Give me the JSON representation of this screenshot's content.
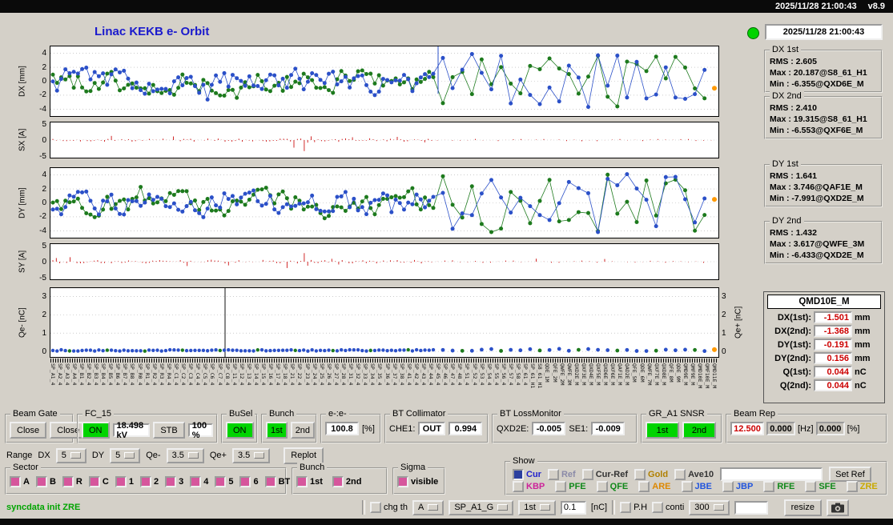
{
  "titlebar": {
    "clock": "2025/11/28 21:00:43",
    "version": "v8.9"
  },
  "header": {
    "title": "Linac KEKB e- Orbit",
    "status_time": "2025/11/28 21:00:43"
  },
  "colors": {
    "on_green": "#00d400",
    "value_red": "#cc0000",
    "check_pink": "#d6569c",
    "check_blue": "#2b3f9e",
    "title_blue": "#1a1acd",
    "status_green": "#00a400",
    "series_green": "#1d7a1d",
    "series_blue": "#2b50c8",
    "spike_red": "#cc1111",
    "endpoint_orange": "#ff9900"
  },
  "plots": {
    "dx": {
      "ylabel": "DX [mm]",
      "ticks": [
        4,
        2,
        0,
        -2,
        -4
      ]
    },
    "sx": {
      "ylabel": "SX [A]",
      "ticks": [
        5,
        0,
        -5
      ]
    },
    "dy": {
      "ylabel": "DY [mm]",
      "ticks": [
        4,
        2,
        0,
        -2,
        -4
      ]
    },
    "sy": {
      "ylabel": "SY [A]",
      "ticks": [
        5,
        0,
        -5
      ]
    },
    "qe": {
      "ylabel": "Qe- [nC]",
      "ylabel_right": "Qe+ [nC]",
      "ticks": [
        3,
        2,
        1,
        0
      ],
      "ticks_right": [
        3,
        2,
        1,
        0
      ]
    }
  },
  "stats": [
    {
      "group": "DX 1st",
      "lines": [
        "RMS : 2.605",
        "Max : 20.187@S8_61_H1",
        "Min : -6.355@QXD6E_M"
      ]
    },
    {
      "group": "DX 2nd",
      "lines": [
        "RMS : 2.410",
        "Max : 19.315@S8_61_H1",
        "Min : -6.553@QXF6E_M"
      ]
    },
    {
      "group": "DY 1st",
      "lines": [
        "RMS : 1.641",
        "Max : 3.746@QAF1E_M",
        "Min : -7.991@QXD2E_M"
      ]
    },
    {
      "group": "DY 2nd",
      "lines": [
        "RMS : 1.432",
        "Max : 3.617@QWFE_3M",
        "Min : -6.433@QXD2E_M"
      ]
    }
  ],
  "monitor": {
    "title": "QMD10E_M",
    "rows": [
      {
        "label": "DX(1st):",
        "value": "-1.501",
        "unit": "mm"
      },
      {
        "label": "DX(2nd):",
        "value": "-1.368",
        "unit": "mm"
      },
      {
        "label": "DY(1st):",
        "value": "-0.191",
        "unit": "mm"
      },
      {
        "label": "DY(2nd):",
        "value": "0.156",
        "unit": "mm"
      },
      {
        "label": "Q(1st):",
        "value": "0.044",
        "unit": "nC"
      },
      {
        "label": "Q(2nd):",
        "value": "0.044",
        "unit": "nC"
      }
    ]
  },
  "controls": {
    "beam_gate": {
      "label": "Beam Gate",
      "close1": "Close",
      "close2": "Close"
    },
    "fc15": {
      "label": "FC_15",
      "on": "ON",
      "kv": "18.498 kV",
      "stb": "STB",
      "pct": "100 %"
    },
    "busel": {
      "label": "BuSel",
      "on": "ON"
    },
    "bunch": {
      "label": "Bunch",
      "first": "1st",
      "second": "2nd"
    },
    "ee": {
      "label": "e-:e-",
      "value": "100.8",
      "unit": "[%]"
    },
    "collimator": {
      "label": "BT Collimator",
      "che1": "CHE1:",
      "out": "OUT",
      "val": "0.994"
    },
    "lossmon": {
      "label": "BT LossMonitor",
      "l1": "QXD2E:",
      "v1": "-0.005",
      "l2": "SE1:",
      "v2": "-0.009"
    },
    "snsr": {
      "label": "GR_A1 SNSR",
      "first": "1st",
      "second": "2nd"
    },
    "beamrep": {
      "label": "Beam Rep",
      "v1": "12.500",
      "v2": "0.000",
      "hz": "[Hz]",
      "v3": "0.000",
      "pct": "[%]"
    }
  },
  "range": {
    "label": "Range",
    "dx": "DX",
    "dx_val": "5",
    "dy": "DY",
    "dy_val": "5",
    "qem": "Qe-",
    "qem_val": "3.5",
    "qep": "Qe+",
    "qep_val": "3.5",
    "replot": "Replot"
  },
  "sector": {
    "label": "Sector",
    "items": [
      "A",
      "B",
      "R",
      "C",
      "1",
      "2",
      "3",
      "4",
      "5",
      "6",
      "BT"
    ]
  },
  "bunch_sel": {
    "label": "Bunch",
    "items": [
      "1st",
      "2nd"
    ]
  },
  "sigma": {
    "label": "Sigma",
    "item": "visible"
  },
  "show": {
    "label": "Show",
    "row1": [
      {
        "label": "Cur",
        "color": "#2222cc",
        "checked": true
      },
      {
        "label": "Ref",
        "color": "#8a8aa8",
        "checked": false
      },
      {
        "label": "Cur-Ref",
        "color": "#333333",
        "checked": false
      },
      {
        "label": "Gold",
        "color": "#b08000",
        "checked": false
      },
      {
        "label": "Ave10",
        "color": "#333333",
        "checked": false
      }
    ],
    "ref_entry": "",
    "set_ref": "Set Ref",
    "row2": [
      {
        "label": "KBP",
        "color": "#cc2299"
      },
      {
        "label": "PFE",
        "color": "#11881a"
      },
      {
        "label": "QFE",
        "color": "#11881a"
      },
      {
        "label": "ARE",
        "color": "#dd8800"
      },
      {
        "label": "JBE",
        "color": "#2255dd"
      },
      {
        "label": "JBP",
        "color": "#2255dd"
      },
      {
        "label": "RFE",
        "color": "#11881a"
      },
      {
        "label": "SFE",
        "color": "#11881a"
      },
      {
        "label": "ZRE",
        "color": "#c8a800"
      }
    ]
  },
  "statusbar": {
    "message": "syncdata init ZRE",
    "chg_th": "chg th",
    "mode": "A",
    "device": "SP_A1_G",
    "bunch": "1st",
    "threshold": "0.1",
    "th_unit": "[nC]",
    "ph": "P.H",
    "conti": "conti",
    "interval": "300",
    "blank": "",
    "resize": "resize"
  },
  "xlabels": [
    "SP_A1_4",
    "SP_A2_4",
    "SP_A3_4",
    "SP_A4_4",
    "SP_B1_4",
    "SP_B2_4",
    "SP_B3_4",
    "SP_B4_4",
    "SP_B5_4",
    "SP_B6_4",
    "SP_B7_4",
    "SP_B8_4",
    "SP_R0_4",
    "SP_R1_4",
    "SP_R2_4",
    "SP_R3_4",
    "SP_R4_4",
    "SP_C1_4",
    "SP_C2_4",
    "SP_C3_4",
    "SP_C4_4",
    "SP_C5_4",
    "SP_C6_4",
    "SP_C7_4",
    "SP_C8_4",
    "SP_11_4",
    "SP_12_4",
    "SP_13_4",
    "SP_14_4",
    "SP_15_4",
    "SP_16_4",
    "SP_17_4",
    "SP_18_4",
    "SP_21_4",
    "SP_22_4",
    "SP_23_4",
    "SP_24_4",
    "SP_25_4",
    "SP_26_4",
    "SP_27_4",
    "SP_28_4",
    "SP_31_4",
    "SP_32_4",
    "SP_33_4",
    "SP_34_4",
    "SP_35_4",
    "SP_36_4",
    "SP_37_4",
    "SP_38_4",
    "SP_41_4",
    "SP_42_4",
    "SP_43_4",
    "SP_44_4",
    "SP_45_4",
    "SP_46_4",
    "SP_47_4",
    "SP_48_4",
    "SP_51_4",
    "SP_52_4",
    "SP_53_4",
    "SP_54_4",
    "SP_55_4",
    "SP_56_4",
    "SP_57_4",
    "SP_58_4",
    "SP_61_4",
    "SP_61_H1",
    "S8_61_H1",
    "QDE_1M",
    "QFE_2M",
    "QWFE_2M",
    "QWFE_3M",
    "QXD2E_M",
    "QXF3E_M",
    "QXD4E_M",
    "QXF5E_M",
    "QXD6E_M",
    "QXF6E_M",
    "QAF1E_M",
    "QAD2E_M",
    "QFE_5M",
    "QDE_6M",
    "QWFE_7M",
    "QXF7E_M",
    "QXD8E_M",
    "QFE_8M",
    "QDE_9M",
    "QMD9E_M",
    "QMF9E_M",
    "QMD10E_M",
    "QMF10E_M",
    "QMD11E_M"
  ]
}
